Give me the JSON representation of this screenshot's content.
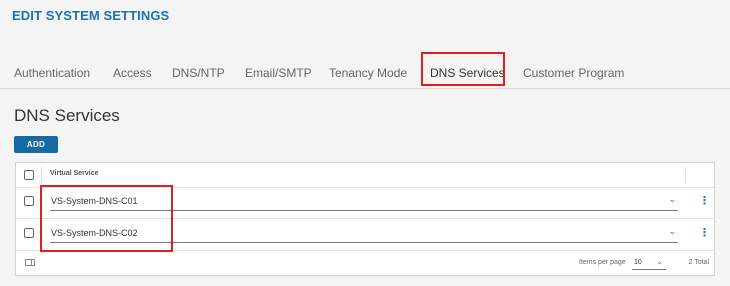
{
  "page": {
    "title": "EDIT SYSTEM SETTINGS"
  },
  "tabs": [
    {
      "label": "Authentication"
    },
    {
      "label": "Access"
    },
    {
      "label": "DNS/NTP"
    },
    {
      "label": "Email/SMTP"
    },
    {
      "label": "Tenancy Mode"
    },
    {
      "label": "DNS Services",
      "active": true
    },
    {
      "label": "Customer Program"
    }
  ],
  "section": {
    "title": "DNS Services",
    "add_label": "ADD"
  },
  "grid": {
    "column_header": "Virtual Service",
    "rows": [
      {
        "value": "VS-System-DNS-C01"
      },
      {
        "value": "VS-System-DNS-C02"
      }
    ],
    "footer": {
      "items_per_page_label": "Items per page",
      "items_per_page_value": "10",
      "total": "2 Total"
    }
  },
  "icons": {
    "chevron": "chevron-down-icon",
    "kebab": "more-vertical-icon",
    "column-toggle": "column-toggle-icon"
  },
  "colors": {
    "accent": "#1a73b7",
    "button": "#1769a4",
    "highlight": "#e02020"
  }
}
